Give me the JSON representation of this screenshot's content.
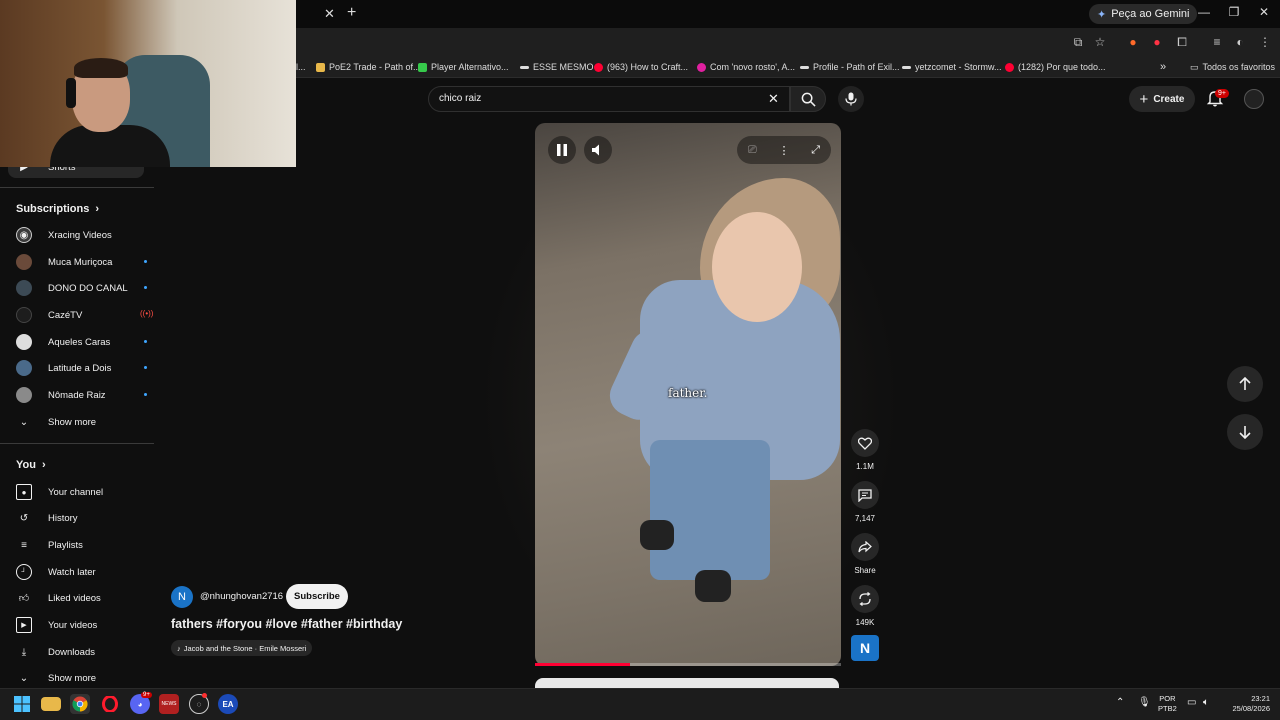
{
  "browser": {
    "gemini_label": "Peça ao Gemini",
    "bookmarks": [
      {
        "label": "PoE2 Trade - Path of...",
        "color": "#e8b84a"
      },
      {
        "label": "Player Alternativo...",
        "color": "#36c94b"
      },
      {
        "label": "ESSE MESMO",
        "color": "#dddddd"
      },
      {
        "label": "(963) How to Craft...",
        "color": "#ff0033"
      },
      {
        "label": "Com 'novo rosto', A...",
        "color": "#e020a0"
      },
      {
        "label": "Profile - Path of Exil...",
        "color": "#dddddd"
      },
      {
        "label": "yetzcomet - Stormw...",
        "color": "#dddddd"
      },
      {
        "label": "(1282) Por que todo...",
        "color": "#ff0033"
      }
    ],
    "bookmarks_more": "»",
    "all_bookmarks": "Todos os favoritos"
  },
  "search": {
    "query": "chico raiz"
  },
  "masthead": {
    "create_label": "Create",
    "notifications_badge": "9+"
  },
  "sidebar": {
    "shorts_label": "Shorts",
    "subscriptions_heading": "Subscriptions",
    "subscriptions": [
      {
        "label": "Xracing Videos",
        "icon": "#3a3a3a",
        "indicator": "none"
      },
      {
        "label": "Muca Muriçoca",
        "icon": "#6a4a3a",
        "indicator": "dot"
      },
      {
        "label": "DONO DO CANAL",
        "icon": "#3c4a55",
        "indicator": "dot"
      },
      {
        "label": "CazéTV",
        "icon": "#1d1d1d",
        "indicator": "live"
      },
      {
        "label": "Aqueles Caras",
        "icon": "#dddddd",
        "indicator": "dot"
      },
      {
        "label": "Latitude a Dois",
        "icon": "#4a6a8a",
        "indicator": "dot"
      },
      {
        "label": "Nômade Raiz",
        "icon": "#8a8a8a",
        "indicator": "dot"
      }
    ],
    "show_more_1": "Show more",
    "you_heading": "You",
    "you_items": [
      {
        "label": "Your channel",
        "icon": "person-box-icon"
      },
      {
        "label": "History",
        "icon": "history-icon"
      },
      {
        "label": "Playlists",
        "icon": "playlists-icon"
      },
      {
        "label": "Watch later",
        "icon": "clock-icon"
      },
      {
        "label": "Liked videos",
        "icon": "thumb-up-icon"
      },
      {
        "label": "Your videos",
        "icon": "play-box-icon"
      },
      {
        "label": "Downloads",
        "icon": "download-icon"
      }
    ],
    "show_more_2": "Show more"
  },
  "short": {
    "caption": "father.",
    "progress": 0.31,
    "likes": "1.1M",
    "comments": "7,147",
    "share_label": "Share",
    "remix_count": "149K",
    "channel_initial": "N",
    "channel_handle": "@nhunghovan2716",
    "subscribe_label": "Subscribe",
    "title": "fathers #foryou #love #father #birthday",
    "music": "Jacob and the Stone · Emile Mosseri"
  },
  "taskbar": {
    "badge_discord": "9+",
    "lang_top": "POR",
    "lang_bottom": "PTB2",
    "time": "23:21",
    "date": "25/08/2026"
  }
}
